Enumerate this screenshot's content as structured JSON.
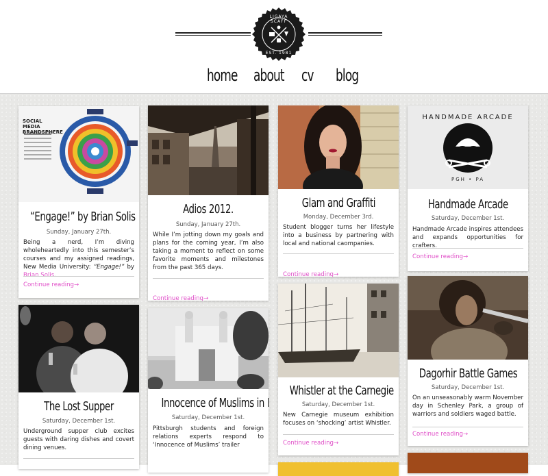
{
  "logo": {
    "top_text": "LIGAYA SCAFF",
    "bottom_text": "EST. 1981"
  },
  "nav": {
    "items": [
      {
        "label": "home"
      },
      {
        "label": "about"
      },
      {
        "label": "cv"
      },
      {
        "label": "blog"
      }
    ]
  },
  "colors": {
    "accent": "#e04fc8",
    "background": "#e8e8e6",
    "text": "#111111"
  },
  "more_label": "Continue reading→",
  "posts": [
    {
      "title": "“Engage!” by Brian Solis",
      "date": "Sunday, January 27th.",
      "excerpt": "Being a nerd, I’m diving wholeheartedly into this semester’s courses and my assigned readings, New Media University: ",
      "excerpt_em": "“Engage!”",
      "excerpt_by": " by ",
      "excerpt_link": "Brian Solis",
      "excerpt_end": ".",
      "image_title": "SOCIAL MEDIA BRANDSPHERE",
      "image_sub": "by Brian Solis & JESS3"
    },
    {
      "title": "Adios 2012.",
      "date": "Sunday, January 27th.",
      "excerpt": "While I’m jotting down my goals and plans for the coming year, I’m also taking a moment to reflect on some favorite moments and milestones from the past 365 days."
    },
    {
      "title": "Glam and Graffiti",
      "date": "Monday, December 3rd.",
      "excerpt": "Student blogger turns her lifestyle into a business by partnering with local and national caompanies."
    },
    {
      "title": "Handmade Arcade",
      "date": "Saturday, December 1st.",
      "excerpt": "Handmade Arcade inspires attendees and expands opportunities for crafters.",
      "image_text": "HANDMADE ARCADE",
      "image_sub": "PGH • PA"
    },
    {
      "title": "The Lost Supper",
      "date": "Saturday, December 1st.",
      "excerpt": "Underground supper club excites guests with daring dishes and covert dining venues."
    },
    {
      "title": "Innocence of Muslims in Pgh",
      "date": "Saturday, December 1st.",
      "excerpt": "Pittsburgh students and foreign relations experts respond to ‘Innocence of Muslims’ trailer"
    },
    {
      "title": "Whistler at the Carnegie",
      "date": "Saturday, December 1st.",
      "excerpt": "New Carnegie museum exhibition focuses on ‘shocking’ artist Whistler."
    },
    {
      "title": "Dagorhir Battle Games",
      "date": "Saturday, December 1st.",
      "excerpt": "On an unseasonably warm November day in Schenley Park, a group of warriors and soldiers waged battle."
    }
  ]
}
